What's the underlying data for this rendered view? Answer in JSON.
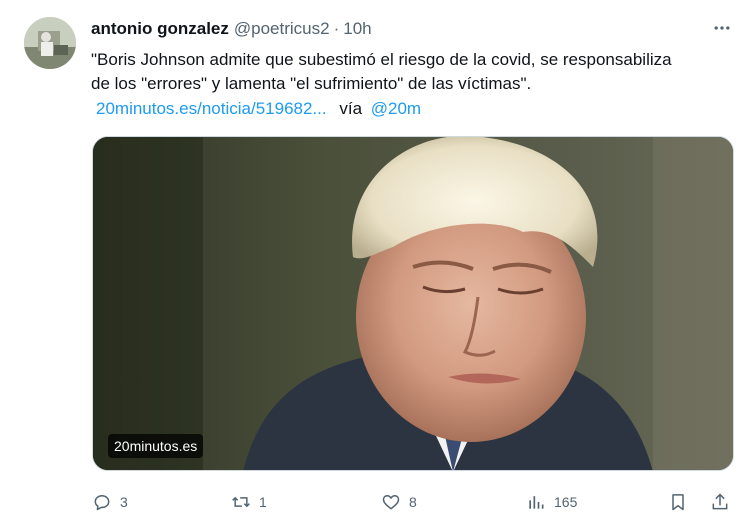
{
  "tweet": {
    "author_name": "antonio gonzalez",
    "author_handle": "@poetricus2",
    "separator": "·",
    "time": "10h",
    "text_lines": [
      "\"Boris Johnson admite que subestimó el riesgo de la covid, se responsabiliza",
      "de los \"errores\" y lamenta \"el sufrimiento\" de las víctimas\"."
    ],
    "link_text": "20minutos.es/noticia/519682...",
    "via_text": "vía",
    "via_handle": "@20m",
    "media_source": "20minutos.es"
  },
  "actions": {
    "reply_count": "3",
    "retweet_count": "1",
    "like_count": "8",
    "views_count": "165"
  },
  "icons": {
    "more": "more-horizontal-icon",
    "reply": "reply-icon",
    "retweet": "retweet-icon",
    "like": "heart-icon",
    "views": "views-chart-icon",
    "bookmark": "bookmark-icon",
    "share": "share-icon"
  },
  "colors": {
    "text_primary": "#0f1419",
    "text_secondary": "#536471",
    "link": "#1d9bf0"
  }
}
